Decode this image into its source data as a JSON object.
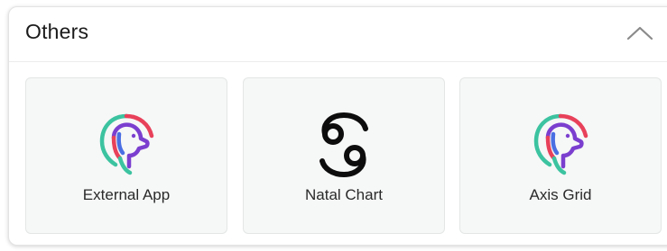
{
  "section": {
    "title": "Others",
    "collapse_icon": "chevron-up-icon"
  },
  "cards": [
    {
      "label": "External App",
      "icon": "dog-logo-icon"
    },
    {
      "label": "Natal Chart",
      "icon": "cancer-zodiac-icon"
    },
    {
      "label": "Axis Grid",
      "icon": "dog-logo-icon"
    }
  ],
  "colors": {
    "logo_red": "#e8415a",
    "logo_purple": "#7b3fcf",
    "logo_blue": "#4a6fe3",
    "logo_green": "#3cc3a0",
    "glyph": "#0d0d0d"
  }
}
